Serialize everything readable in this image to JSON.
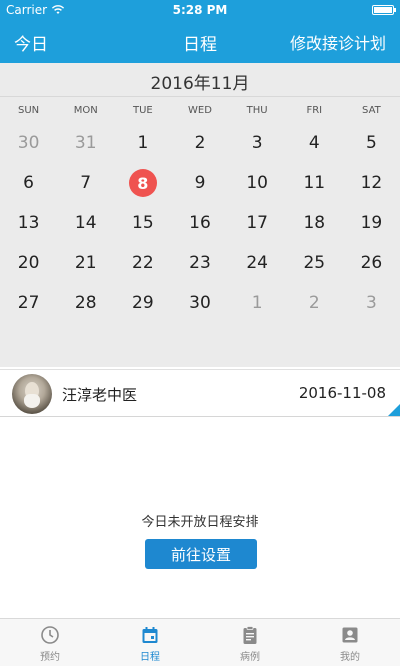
{
  "status_bar": {
    "carrier": "Carrier",
    "time": "5:28 PM",
    "battery_level": 1.0
  },
  "nav": {
    "today_label": "今日",
    "title": "日程",
    "edit_label": "修改接诊计划"
  },
  "calendar": {
    "month_title": "2016年11月",
    "weekdays": [
      "SUN",
      "MON",
      "TUE",
      "WED",
      "THU",
      "FRI",
      "SAT"
    ],
    "days": [
      {
        "n": "30",
        "other": true
      },
      {
        "n": "31",
        "other": true
      },
      {
        "n": "1"
      },
      {
        "n": "2"
      },
      {
        "n": "3"
      },
      {
        "n": "4"
      },
      {
        "n": "5"
      },
      {
        "n": "6"
      },
      {
        "n": "7"
      },
      {
        "n": "8",
        "today": true
      },
      {
        "n": "9"
      },
      {
        "n": "10"
      },
      {
        "n": "11"
      },
      {
        "n": "12"
      },
      {
        "n": "13"
      },
      {
        "n": "14"
      },
      {
        "n": "15"
      },
      {
        "n": "16"
      },
      {
        "n": "17"
      },
      {
        "n": "18"
      },
      {
        "n": "19"
      },
      {
        "n": "20"
      },
      {
        "n": "21"
      },
      {
        "n": "22"
      },
      {
        "n": "23"
      },
      {
        "n": "24"
      },
      {
        "n": "25"
      },
      {
        "n": "26"
      },
      {
        "n": "27"
      },
      {
        "n": "28"
      },
      {
        "n": "29"
      },
      {
        "n": "30"
      },
      {
        "n": "1",
        "other": true
      },
      {
        "n": "2",
        "other": true
      },
      {
        "n": "3",
        "other": true
      }
    ]
  },
  "doctor": {
    "name": "汪淳老中医",
    "date": "2016-11-08"
  },
  "empty_state": {
    "message": "今日未开放日程安排",
    "button_label": "前往设置"
  },
  "tabbar": {
    "items": [
      {
        "label": "预约",
        "icon": "clock-icon",
        "active": false
      },
      {
        "label": "日程",
        "icon": "calendar-icon",
        "active": true
      },
      {
        "label": "病例",
        "icon": "clipboard-icon",
        "active": false
      },
      {
        "label": "我的",
        "icon": "person-icon",
        "active": false
      }
    ]
  },
  "colors": {
    "primary": "#1e9fdb",
    "today_highlight": "#ef5350",
    "button": "#1e88d0",
    "calendar_bg": "#ebebeb"
  }
}
